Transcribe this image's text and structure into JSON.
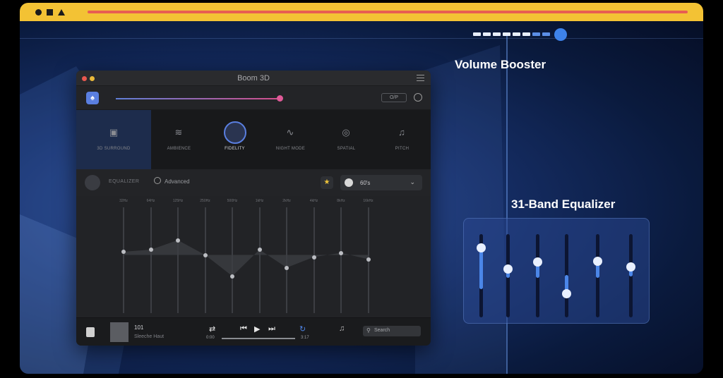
{
  "callouts": {
    "volume_booster": "Volume Booster",
    "equalizer_31": "31-Band Equalizer"
  },
  "app": {
    "title": "Boom 3D",
    "output_button": "O/P",
    "effects": [
      {
        "label": "3D SURROUND",
        "icon": "cube-icon"
      },
      {
        "label": "AMBIENCE",
        "icon": "ambience-icon"
      },
      {
        "label": "FIDELITY",
        "icon": "fidelity-icon"
      },
      {
        "label": "NIGHT MODE",
        "icon": "waveform-icon"
      },
      {
        "label": "SPATIAL",
        "icon": "spatial-icon"
      },
      {
        "label": "PITCH",
        "icon": "music-note-icon"
      }
    ],
    "equalizer": {
      "label": "EQUALIZER",
      "advanced_label": "Advanced",
      "preset": "60's",
      "bands": [
        "32Hz",
        "64Hz",
        "125Hz",
        "250Hz",
        "500Hz",
        "1kHz",
        "2kHz",
        "4kHz",
        "8kHz",
        "16kHz"
      ],
      "band_levels": [
        0.58,
        0.6,
        0.69,
        0.55,
        0.35,
        0.6,
        0.43,
        0.53,
        0.57,
        0.51
      ]
    },
    "player": {
      "track": "101",
      "artist": "Sleeche Haut",
      "time_current": "0:00",
      "time_total": "3:17",
      "search_placeholder": "Search"
    }
  }
}
